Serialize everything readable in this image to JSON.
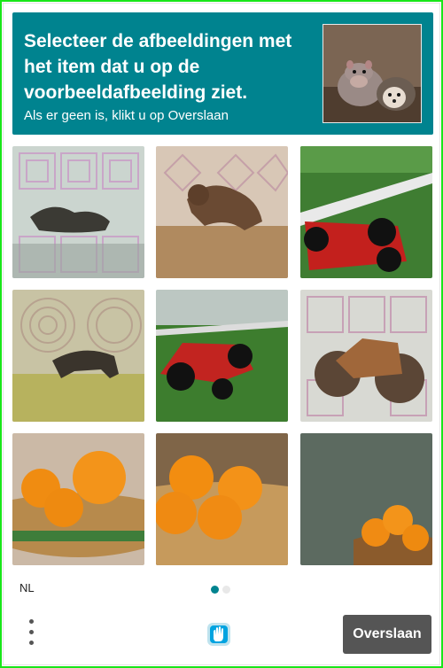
{
  "header": {
    "title": "Selecteer de afbeeldingen met het item dat u op de voorbeeldafbeelding ziet.",
    "subtitle": "Als er geen is, klikt u op Overslaan",
    "sample_image": "hippo-and-hedgehog-photo"
  },
  "grid": [
    {
      "subject": "leopard-pattern-tile"
    },
    {
      "subject": "lion-leaping-tile"
    },
    {
      "subject": "race-car-tile"
    },
    {
      "subject": "leopard-running-tile"
    },
    {
      "subject": "race-car-tile"
    },
    {
      "subject": "motorcycle-tile"
    },
    {
      "subject": "orange-basket-tile"
    },
    {
      "subject": "orange-basket-tile"
    },
    {
      "subject": "orange-basket-tile"
    }
  ],
  "footer": {
    "language": "NL",
    "skip_label": "Overslaan",
    "page_current": 1,
    "page_total": 2
  },
  "colors": {
    "accent": "#00838f",
    "frame": "#19e619",
    "skip_button": "#555555"
  }
}
